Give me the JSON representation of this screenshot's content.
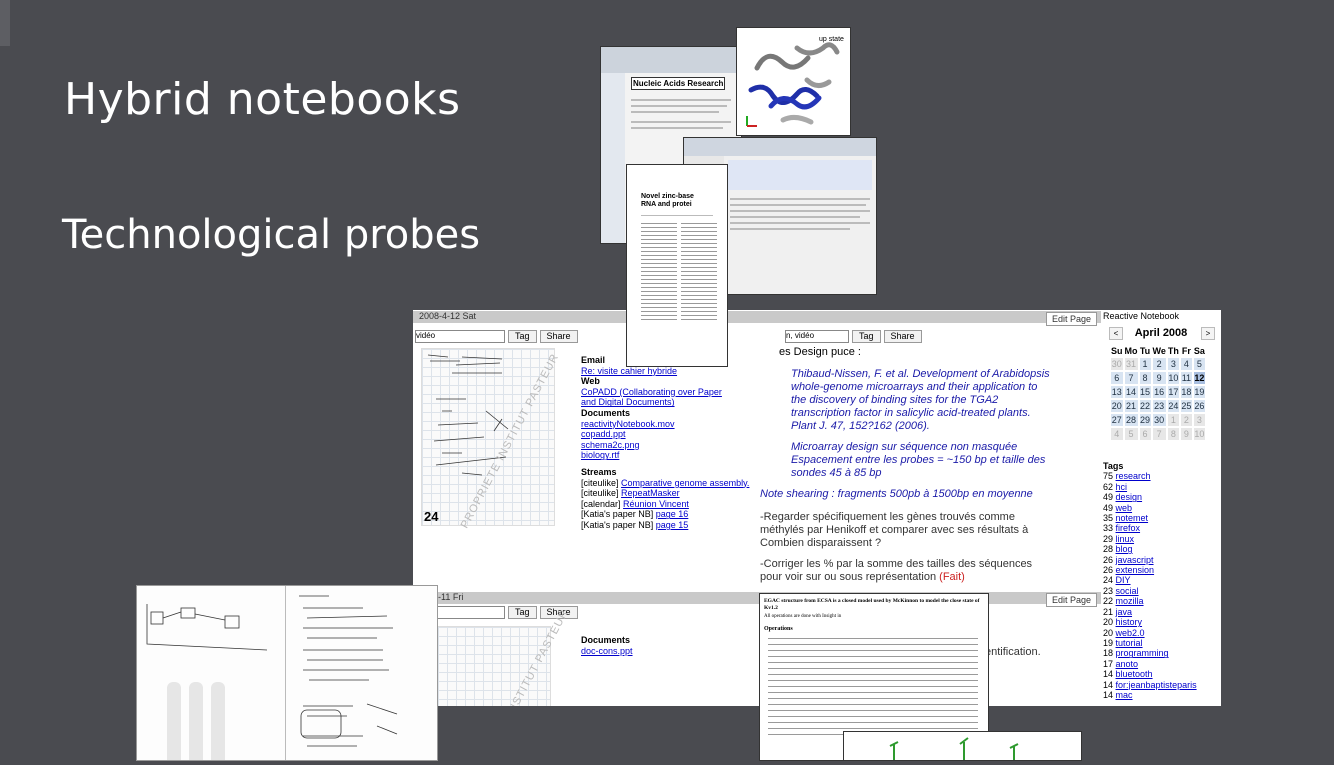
{
  "slide": {
    "title": "Hybrid notebooks",
    "subtitle": "Technological probes"
  },
  "notebook": {
    "entry1": {
      "date": "2008-4-12 Sat",
      "edit_label": "Edit Page",
      "tag_input": "vidéo",
      "tag_input2": "n, vidéo",
      "tag_button": "Tag",
      "share_button": "Share",
      "sketch_page_number": "24",
      "watermark": "PROPRIETE INSTITUT PASTEUR",
      "email_heading": "Email",
      "email_link": "Re: visite cahier hybride",
      "web_heading": "Web",
      "web_link1": "CoPADD (Collaborating over Paper",
      "web_link2": "and Digital Documents)",
      "docs_heading": "Documents",
      "docs": [
        "reactivityNotebook.mov",
        "copadd.ppt",
        "schema2c.png",
        "biology.rtf"
      ],
      "streams_heading": "Streams",
      "streams": [
        {
          "prefix": "[citeulike]",
          "link": "Comparative genome assembly."
        },
        {
          "prefix": "[citeulike]",
          "link": "RepeatMasker"
        },
        {
          "prefix": "[calendar]",
          "link": "Réunion Vincent"
        },
        {
          "prefix": "[Katia's paper NB]",
          "link": "page 16"
        },
        {
          "prefix": "[Katia's paper NB]",
          "link": "page 15"
        }
      ],
      "note_head": "es Design puce :",
      "ref_lines": [
        "Thibaud-Nissen, F. et al. Development of Arabidopsis",
        "whole-genome microarrays and their application to",
        "the discovery of binding sites for the TGA2",
        "transcription factor in salicylic acid-treated plants.",
        "Plant J. 47, 152?162 (2006)."
      ],
      "micro_lines": [
        "Microarray design sur séquence non masquée",
        "Espacement entre les probes = ~150 bp et taille des",
        "sondes 45 à 85 bp"
      ],
      "shearing": "Note shearing : fragments 500pb à 1500bp en moyenne",
      "para1": [
        "-Regarder spécifiquement les gènes trouvés comme",
        "méthylés par Henikoff et comparer avec ses résultats à",
        "Combien disparaissent ?"
      ],
      "para2_lines": [
        "-Corriger les % par la somme des tailles des séquences",
        "pour voir sur ou sous représentation"
      ],
      "para2_done": "(Fait)"
    },
    "entry2": {
      "date": "4-11 Fri",
      "edit_label": "Edit Page",
      "tag_button": "Tag",
      "share_button": "Share",
      "docs_heading": "Documents",
      "doc_link": "doc-cons.ppt",
      "watermark": "INSTITUT PASTEUR",
      "tail_text": "entification."
    }
  },
  "calendar": {
    "header": "Reactive Notebook",
    "month": "April 2008",
    "prev": "<",
    "next": ">",
    "weekdays": [
      "Su",
      "Mo",
      "Tu",
      "We",
      "Th",
      "Fr",
      "Sa"
    ],
    "weeks": [
      [
        "30",
        "31",
        "1",
        "2",
        "3",
        "4",
        "5"
      ],
      [
        "6",
        "7",
        "8",
        "9",
        "10",
        "11",
        "12"
      ],
      [
        "13",
        "14",
        "15",
        "16",
        "17",
        "18",
        "19"
      ],
      [
        "20",
        "21",
        "22",
        "23",
        "24",
        "25",
        "26"
      ],
      [
        "27",
        "28",
        "29",
        "30",
        "1",
        "2",
        "3"
      ],
      [
        "4",
        "5",
        "6",
        "7",
        "8",
        "9",
        "10"
      ]
    ],
    "today": "12",
    "tags_heading": "Tags",
    "tags": [
      {
        "count": "75",
        "name": "research"
      },
      {
        "count": "62",
        "name": "hci"
      },
      {
        "count": "49",
        "name": "design"
      },
      {
        "count": "49",
        "name": "web"
      },
      {
        "count": "35",
        "name": "notemet"
      },
      {
        "count": "33",
        "name": "firefox"
      },
      {
        "count": "29",
        "name": "linux"
      },
      {
        "count": "28",
        "name": "blog"
      },
      {
        "count": "26",
        "name": "javascript"
      },
      {
        "count": "26",
        "name": "extension"
      },
      {
        "count": "24",
        "name": "DIY"
      },
      {
        "count": "23",
        "name": "social"
      },
      {
        "count": "22",
        "name": "mozilla"
      },
      {
        "count": "21",
        "name": "java"
      },
      {
        "count": "20",
        "name": "history"
      },
      {
        "count": "20",
        "name": "web2.0"
      },
      {
        "count": "19",
        "name": "tutorial"
      },
      {
        "count": "18",
        "name": "programming"
      },
      {
        "count": "17",
        "name": "anoto"
      },
      {
        "count": "14",
        "name": "bluetooth"
      },
      {
        "count": "14",
        "name": "for:jeanbaptisteparis"
      },
      {
        "count": "14",
        "name": "mac"
      }
    ]
  },
  "thumbnails": {
    "journal_title": "Nucleic Acids Research",
    "protein_label": "up state",
    "paper_title_1": "Novel zinc-base",
    "paper_title_2": "RNA and protei",
    "doc_title": "EGAC structure from ECSA is a closed model used by McKinnon to model the close state of Kv1.2",
    "doc_sub": "All operations are done with Insight in",
    "doc_heading": "Operations"
  },
  "colors": {
    "background": "#4a4b50",
    "link": "#0000cc",
    "note_blue": "#1a1aa8",
    "done_red": "#cc2222",
    "calendar_today": "#a9bfe0"
  }
}
